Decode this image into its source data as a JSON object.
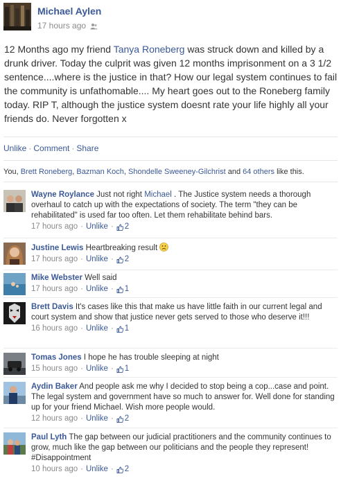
{
  "post": {
    "author": "Michael Aylen",
    "timestamp": "17 hours ago",
    "body_before_link": "12 Months ago my friend ",
    "body_link": "Tanya Roneberg",
    "body_after_link": " was struck down and killed by a drunk driver. Today the culprit was given 12 months imprisonment on a 3 1/2 sentence....where is the justice in that? How our legal system continues to fail the community is unfathomable.... My heart goes out to the Roneberg family today. RIP T, although the justice system doesnt rate your life highly all your friends do. Never forgotten x",
    "actions": {
      "unlike": "Unlike",
      "comment": "Comment",
      "share": "Share"
    },
    "likes": {
      "prefix": "You, ",
      "names": [
        "Brett Roneberg",
        "Bazman Koch",
        "Shondelle Sweeney-Gilchrist"
      ],
      "and": " and ",
      "others": "64 others",
      "suffix": " like this."
    }
  },
  "comments": [
    {
      "name": "Wayne Roylance",
      "text_before": " Just not right ",
      "mention": "Michael",
      "text_after": " . The Justice system needs a thorough overhaul to catch up with the expectations of society. The term \"they can be rehabilitated\" is used far too often. Let them rehabilitate behind bars.",
      "time": "17 hours ago",
      "unlike": "Unlike",
      "likes": "2"
    },
    {
      "name": "Justine Lewis",
      "text": " Heartbreaking result ",
      "emoji": "sad-face-icon",
      "time": "17 hours ago",
      "unlike": "Unlike",
      "likes": "2"
    },
    {
      "name": "Mike Webster",
      "text": " Well said",
      "time": "17 hours ago",
      "unlike": "Unlike",
      "likes": "1"
    },
    {
      "name": "Brett Davis",
      "text": " It's cases like this that make us have little faith in our current legal and court system and show that justice never gets served to those who deserve it!!!",
      "time": "16 hours ago",
      "unlike": "Unlike",
      "likes": "1"
    },
    {
      "name": "Tomas Jones",
      "text": " I hope he has trouble sleeping at night",
      "time": "15 hours ago",
      "unlike": "Unlike",
      "likes": "1"
    },
    {
      "name": "Aydin Baker",
      "text": " And people ask me why I decided to stop being a cop...case and point. The legal system and government have so much to answer for. Well done for standing up for your friend Michael. Wish more people would.",
      "time": "12 hours ago",
      "unlike": "Unlike",
      "likes": "2"
    },
    {
      "name": "Paul Lyth",
      "text": " The gap between our judicial practitioners and the community continues to grow, much like the gap between our politicians and the people they represent! #Disappointment",
      "time": "10 hours ago",
      "unlike": "Unlike",
      "likes": "2"
    }
  ],
  "colors": {
    "link": "#3b5998",
    "meta": "#8a8a8a",
    "text": "#333333"
  }
}
